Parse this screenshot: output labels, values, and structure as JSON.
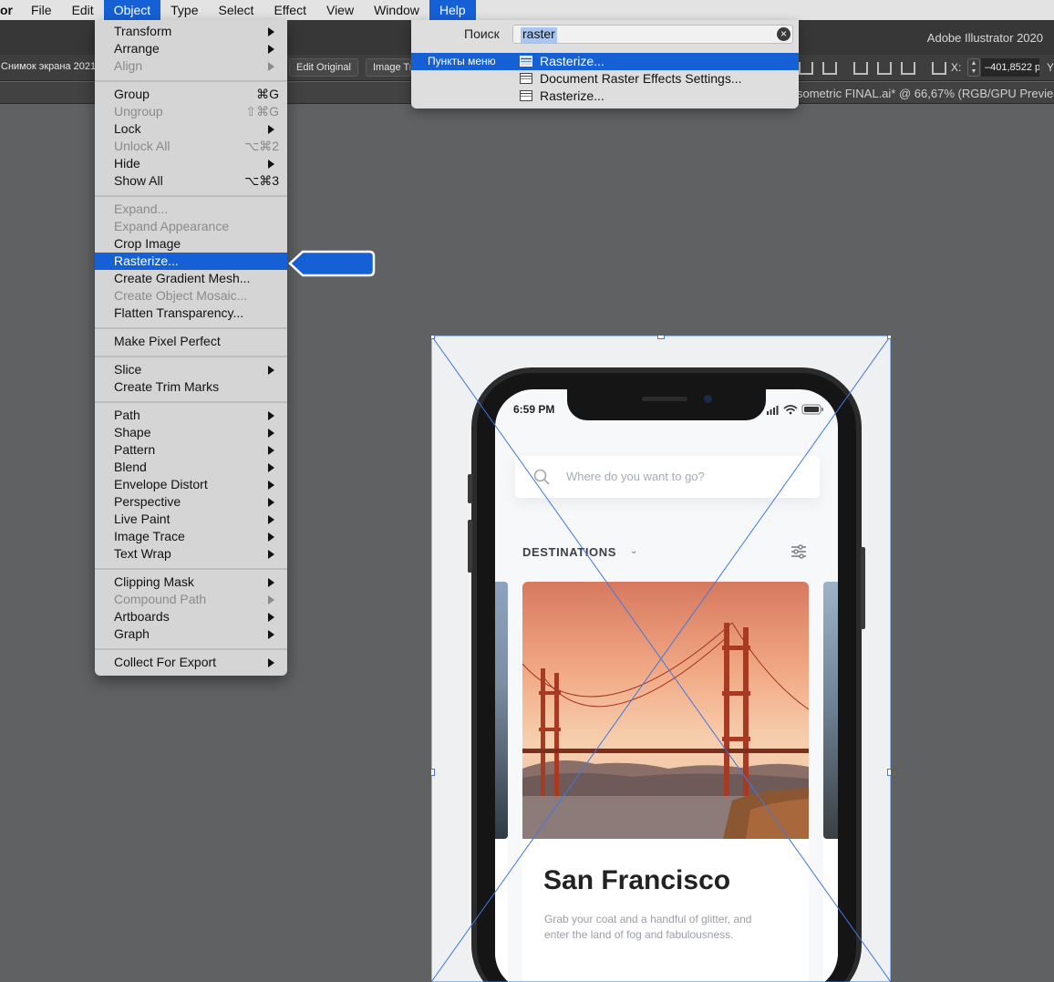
{
  "menubar": {
    "app_fragment": "or",
    "items": [
      "File",
      "Edit",
      "Object",
      "Type",
      "Select",
      "Effect",
      "View",
      "Window",
      "Help"
    ],
    "active_item": "Object"
  },
  "appbar": {
    "title": "Adobe Illustrator 2020"
  },
  "control_bar": {
    "doc_label": "Снимок экрана 2021",
    "edit_original_label": "Edit Original",
    "image_trace_label": "Image Trace",
    "x_label": "X:",
    "x_value": "–401,8522 p",
    "y_label": "Y:"
  },
  "document_tab": {
    "title": "sometric FINAL.ai* @ 66,67% (RGB/GPU Previe"
  },
  "help_popup": {
    "search_label": "Поиск",
    "search_value": "raster",
    "category_label": "Пункты меню",
    "results": [
      {
        "label": "Rasterize...",
        "selected": true
      },
      {
        "label": "Document Raster Effects Settings...",
        "selected": false
      },
      {
        "label": "Rasterize...",
        "selected": false
      }
    ]
  },
  "object_menu": {
    "items": [
      {
        "label": "Transform",
        "submenu": true
      },
      {
        "label": "Arrange",
        "submenu": true
      },
      {
        "label": "Align",
        "submenu": true,
        "disabled": true
      },
      {
        "label": "Group",
        "shortcut": "⌘G"
      },
      {
        "label": "Ungroup",
        "shortcut": "⇧⌘G",
        "disabled": true
      },
      {
        "label": "Lock",
        "submenu": true
      },
      {
        "label": "Unlock All",
        "shortcut": "⌥⌘2",
        "disabled": true
      },
      {
        "label": "Hide",
        "submenu": true
      },
      {
        "label": "Show All",
        "shortcut": "⌥⌘3"
      },
      {
        "label": "Expand...",
        "disabled": true
      },
      {
        "label": "Expand Appearance",
        "disabled": true
      },
      {
        "label": "Crop Image"
      },
      {
        "label": "Rasterize...",
        "selected": true
      },
      {
        "label": "Create Gradient Mesh..."
      },
      {
        "label": "Create Object Mosaic...",
        "disabled": true
      },
      {
        "label": "Flatten Transparency..."
      },
      {
        "label": "Make Pixel Perfect"
      },
      {
        "label": "Slice",
        "submenu": true
      },
      {
        "label": "Create Trim Marks"
      },
      {
        "label": "Path",
        "submenu": true
      },
      {
        "label": "Shape",
        "submenu": true
      },
      {
        "label": "Pattern",
        "submenu": true
      },
      {
        "label": "Blend",
        "submenu": true
      },
      {
        "label": "Envelope Distort",
        "submenu": true
      },
      {
        "label": "Perspective",
        "submenu": true
      },
      {
        "label": "Live Paint",
        "submenu": true
      },
      {
        "label": "Image Trace",
        "submenu": true
      },
      {
        "label": "Text Wrap",
        "submenu": true
      },
      {
        "label": "Clipping Mask",
        "submenu": true
      },
      {
        "label": "Compound Path",
        "submenu": true,
        "disabled": true
      },
      {
        "label": "Artboards",
        "submenu": true
      },
      {
        "label": "Graph",
        "submenu": true
      },
      {
        "label": "Collect For Export",
        "submenu": true
      }
    ]
  },
  "artwork": {
    "time": "6:59 PM",
    "search_placeholder": "Where do you want to go?",
    "destinations_label": "DESTINATIONS",
    "city": "San Francisco",
    "blurb": "Grab your coat and a handful of glitter, and enter the land of fog and fabulousness."
  },
  "colors": {
    "selection_blue": "#1560d4",
    "bounding_box": "#3f78e0",
    "canvas": "#5f6163"
  },
  "icons": [
    "clear-search-icon",
    "menu-item-icon",
    "submenu-arrow-icon",
    "callout-arrow-icon",
    "search-icon",
    "filter-icon",
    "signal-icon",
    "wifi-icon",
    "battery-icon",
    "chevron-down-icon",
    "align-icon",
    "transform-icon"
  ]
}
